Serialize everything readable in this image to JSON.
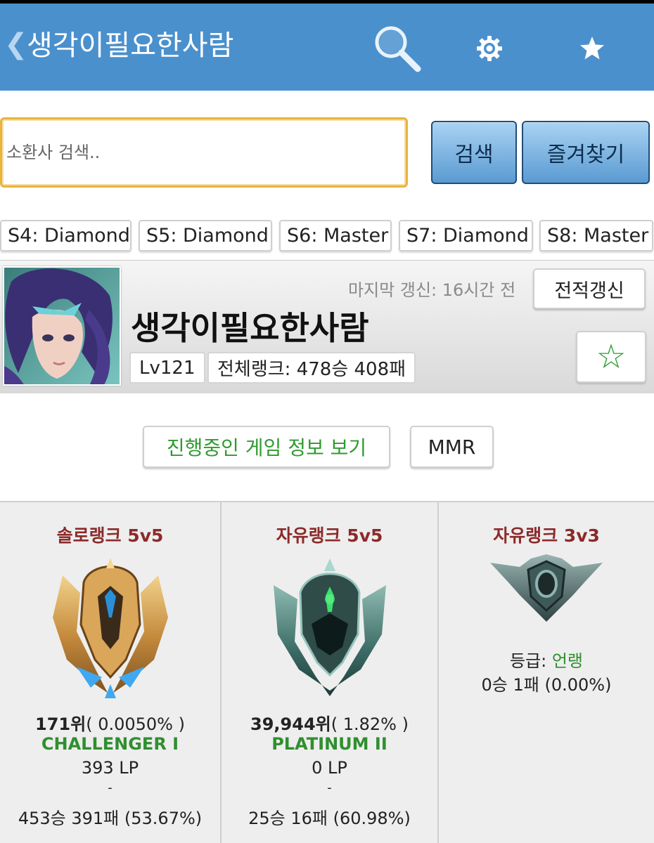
{
  "header": {
    "back_glyph": "❮",
    "title": "생각이필요한사람",
    "icons": [
      "search-icon",
      "gear-icon",
      "star-icon"
    ],
    "bg_color": "#4a90cd"
  },
  "search": {
    "placeholder": "소환사 검색..",
    "value": "",
    "search_button": "검색",
    "favorites_button": "즐겨찾기"
  },
  "seasons": [
    {
      "label": "S4: Diamond"
    },
    {
      "label": "S5: Diamond"
    },
    {
      "label": "S6: Master"
    },
    {
      "label": "S7: Diamond"
    },
    {
      "label": "S8: Master"
    }
  ],
  "profile": {
    "last_update": "마지막 갱신: 16시간 전",
    "refresh_button": "전적갱신",
    "summoner_name": "생각이필요한사람",
    "level": "Lv121",
    "total_rank": "전체랭크: 478승 408패",
    "favorite_star": "☆"
  },
  "actions": {
    "live_game": "진행중인 게임 정보 보기",
    "mmr": "MMR"
  },
  "ranks": [
    {
      "queue": "솔로랭크 5v5",
      "emblem": "challenger-emblem-icon",
      "position": "171위",
      "percent": "( 0.0050% )",
      "tier": "CHALLENGER I",
      "lp": "393 LP",
      "dash": "-",
      "record": "453승 391패 (53.67%)"
    },
    {
      "queue": "자유랭크 5v5",
      "emblem": "platinum-emblem-icon",
      "position": "39,944위",
      "percent": "( 1.82% )",
      "tier": "PLATINUM II",
      "lp": "0 LP",
      "dash": "-",
      "record": "25승 16패 (60.98%)"
    },
    {
      "queue": "자유랭크 3v3",
      "emblem": "unranked-emblem-icon",
      "grade_label": "등급: ",
      "grade_value": "언랭",
      "record": "0승 1패 (0.00%)"
    }
  ]
}
